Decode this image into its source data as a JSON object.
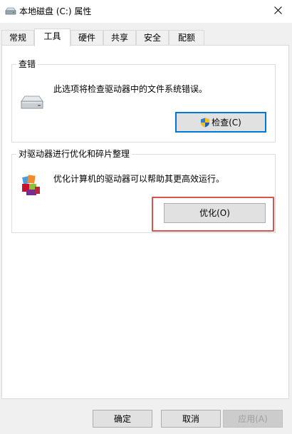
{
  "window": {
    "title": "本地磁盘 (C:) 属性"
  },
  "tabs": [
    {
      "label": "常规"
    },
    {
      "label": "工具"
    },
    {
      "label": "硬件"
    },
    {
      "label": "共享"
    },
    {
      "label": "安全"
    },
    {
      "label": "配额"
    }
  ],
  "active_tab": "工具",
  "error_check": {
    "title": "查错",
    "description": "此选项将检查驱动器中的文件系统错误。",
    "button_label": "检查(C)",
    "button_icon": "uac-shield-icon"
  },
  "optimize": {
    "title": "对驱动器进行优化和碎片整理",
    "description": "优化计算机的驱动器可以帮助其更高效运行。",
    "button_label": "优化(O)",
    "highlight_color": "#d9534f"
  },
  "footer": {
    "ok_label": "确定",
    "cancel_label": "取消",
    "apply_label": "应用(A)"
  },
  "colors": {
    "default_button_border": "#0078d7"
  }
}
